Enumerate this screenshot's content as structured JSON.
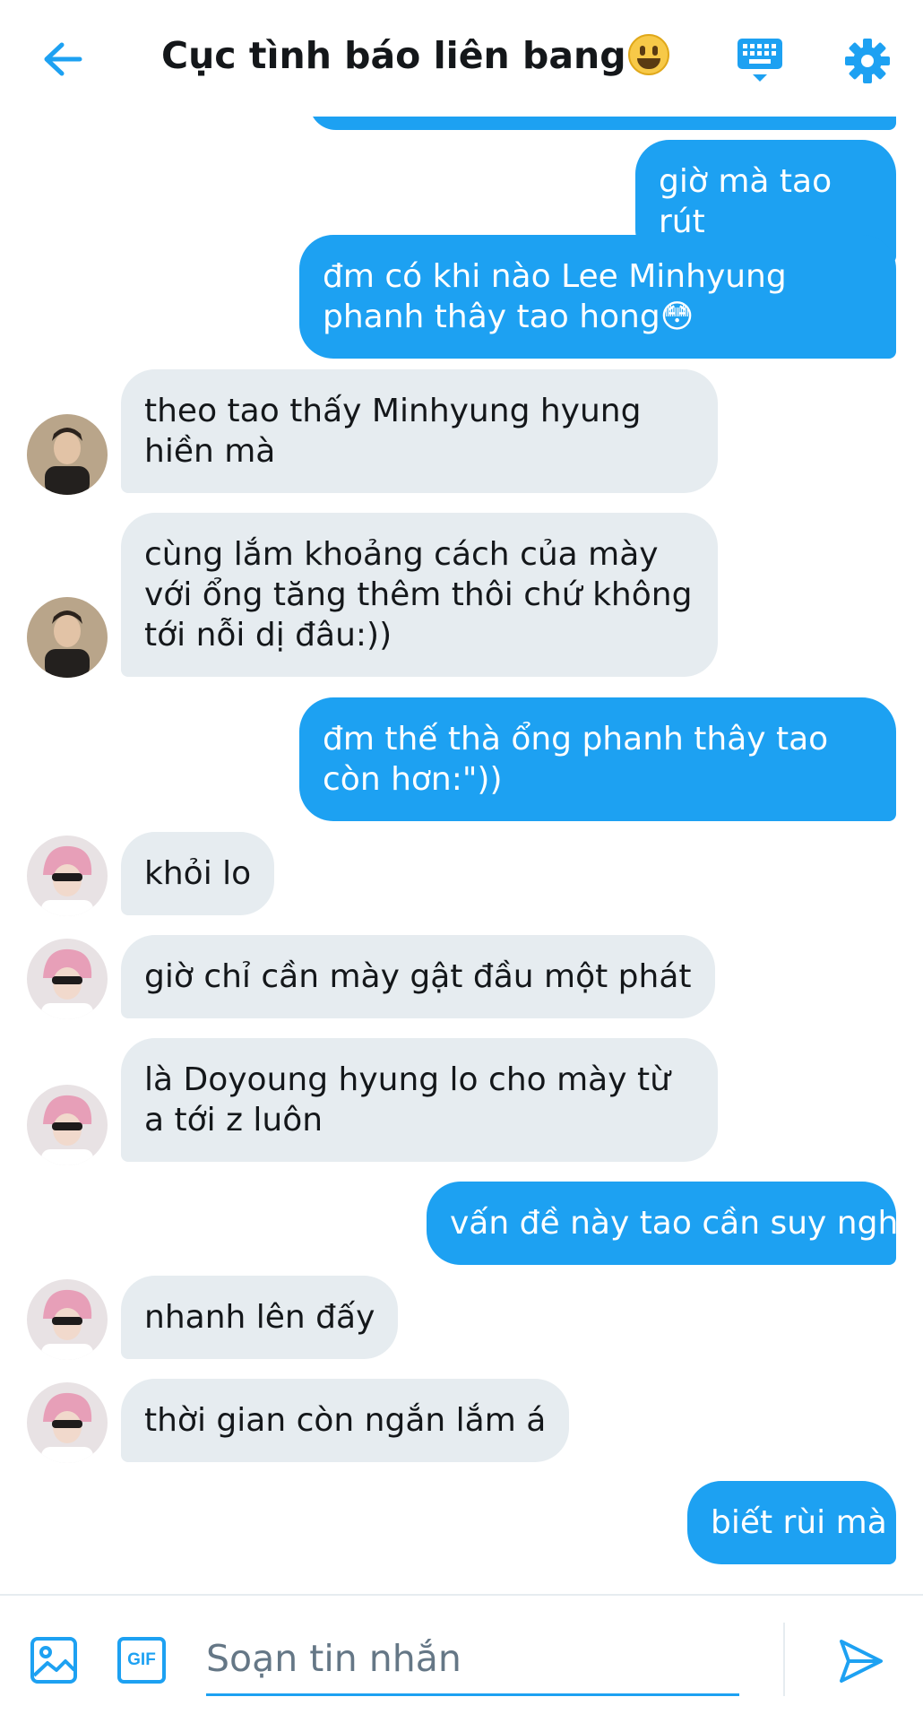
{
  "header": {
    "title": "Cục tình báo liên bang",
    "back_icon": "arrow-left-icon",
    "keyboard_icon": "keyboard-icon",
    "settings_icon": "gear-icon",
    "accent": "#1da1f2"
  },
  "messages": [
    {
      "side": "out",
      "text": "giờ mà tao rút"
    },
    {
      "side": "out",
      "text": "đm có khi nào Lee Minhyung phanh thây tao hong😳"
    },
    {
      "side": "in",
      "avatar": "dark",
      "text": "theo tao thấy Minhyung hyung hiền mà"
    },
    {
      "side": "in",
      "avatar": "dark",
      "text": "cùng lắm khoảng cách của mày với ổng tăng thêm thôi chứ không tới nỗi dị đâu:))"
    },
    {
      "side": "out",
      "text": "đm thế thà ổng phanh thây tao còn hơn:\"))"
    },
    {
      "side": "in",
      "avatar": "pink",
      "text": "khỏi lo"
    },
    {
      "side": "in",
      "avatar": "pink",
      "text": "giờ chỉ cần mày gật đầu một phát"
    },
    {
      "side": "in",
      "avatar": "pink",
      "text": "là Doyoung hyung lo cho mày từ a tới z luôn"
    },
    {
      "side": "out",
      "text": "vấn đề này tao cần suy nghĩ"
    },
    {
      "side": "in",
      "avatar": "pink",
      "text": "nhanh lên đấy"
    },
    {
      "side": "in",
      "avatar": "pink",
      "text": "thời gian còn ngắn lắm á"
    },
    {
      "side": "out",
      "text": "biết rùi mà"
    }
  ],
  "composer": {
    "placeholder": "Soạn tin nhắn",
    "image_icon": "image-icon",
    "gif_label": "GIF",
    "send_icon": "send-icon"
  }
}
